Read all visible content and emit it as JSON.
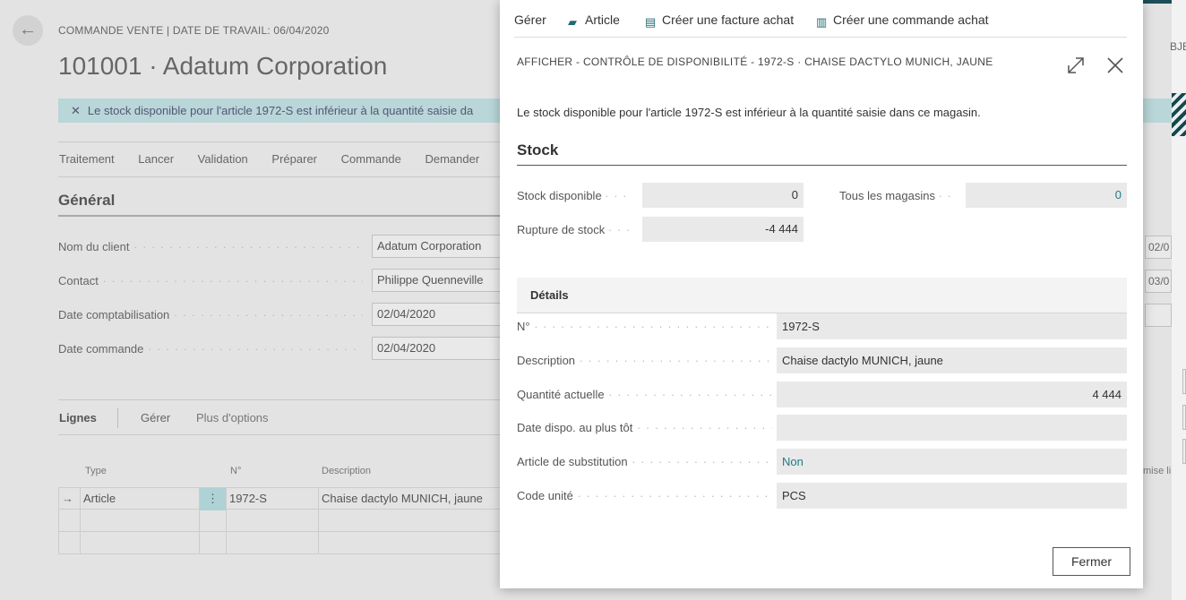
{
  "background": {
    "breadcrumb": "COMMANDE VENTE | DATE DE TRAVAIL: 06/04/2020",
    "title": "101001 · Adatum Corporation",
    "banner_text": "Le stock disponible pour l'article 1972-S est inférieur à la quantité saisie da",
    "actions": [
      "Traitement",
      "Lancer",
      "Validation",
      "Préparer",
      "Commande",
      "Demander"
    ],
    "section_title": "Général",
    "fields": [
      {
        "label": "Nom du client",
        "value": "Adatum Corporation"
      },
      {
        "label": "Contact",
        "value": "Philippe Quenneville"
      },
      {
        "label": "Date comptabilisation",
        "value": "02/04/2020"
      },
      {
        "label": "Date commande",
        "value": "02/04/2020"
      }
    ],
    "right_fields": [
      "02/0",
      "03/0",
      ""
    ],
    "right_text": "BJE",
    "lines": {
      "title": "Lignes",
      "manage": "Gérer",
      "more": "Plus d'options",
      "columns": {
        "type": "Type",
        "no": "N°",
        "description": "Description",
        "mise": "mise li"
      },
      "rows": [
        {
          "arrow": "→",
          "type": "Article",
          "menu": "⋮",
          "no": "1972-S",
          "description": "Chaise dactylo MUNICH, jaune"
        }
      ]
    }
  },
  "dialog": {
    "actions": [
      {
        "label": "Gérer"
      },
      {
        "label": "Article",
        "icon": "item-icon"
      },
      {
        "label": "Créer une facture achat",
        "icon": "purchase-invoice-icon"
      },
      {
        "label": "Créer une commande achat",
        "icon": "purchase-order-icon"
      }
    ],
    "title": "AFFICHER - CONTRÔLE DE DISPONIBILITÉ - 1972-S · CHAISE DACTYLO MUNICH, JAUNE",
    "message": "Le stock disponible pour l'article 1972-S est inférieur à la quantité saisie dans ce magasin.",
    "stock": {
      "title": "Stock",
      "stock_disponible": {
        "label": "Stock disponible",
        "value": "0"
      },
      "tous_magasins": {
        "label": "Tous les magasins",
        "value": "0"
      },
      "rupture": {
        "label": "Rupture de stock",
        "value": "-4 444"
      }
    },
    "details": {
      "title": "Détails",
      "rows": [
        {
          "label": "N°",
          "value": "1972-S"
        },
        {
          "label": "Description",
          "value": "Chaise dactylo MUNICH, jaune"
        },
        {
          "label": "Quantité actuelle",
          "value": "4 444"
        },
        {
          "label": "Date dispo. au plus tôt",
          "value": ""
        },
        {
          "label": "Article de substitution",
          "value": "Non"
        },
        {
          "label": "Code unité",
          "value": "PCS"
        }
      ]
    },
    "close_button": "Fermer"
  },
  "colors": {
    "accent": "#1e7b86",
    "banner": "#b9d6d8"
  }
}
